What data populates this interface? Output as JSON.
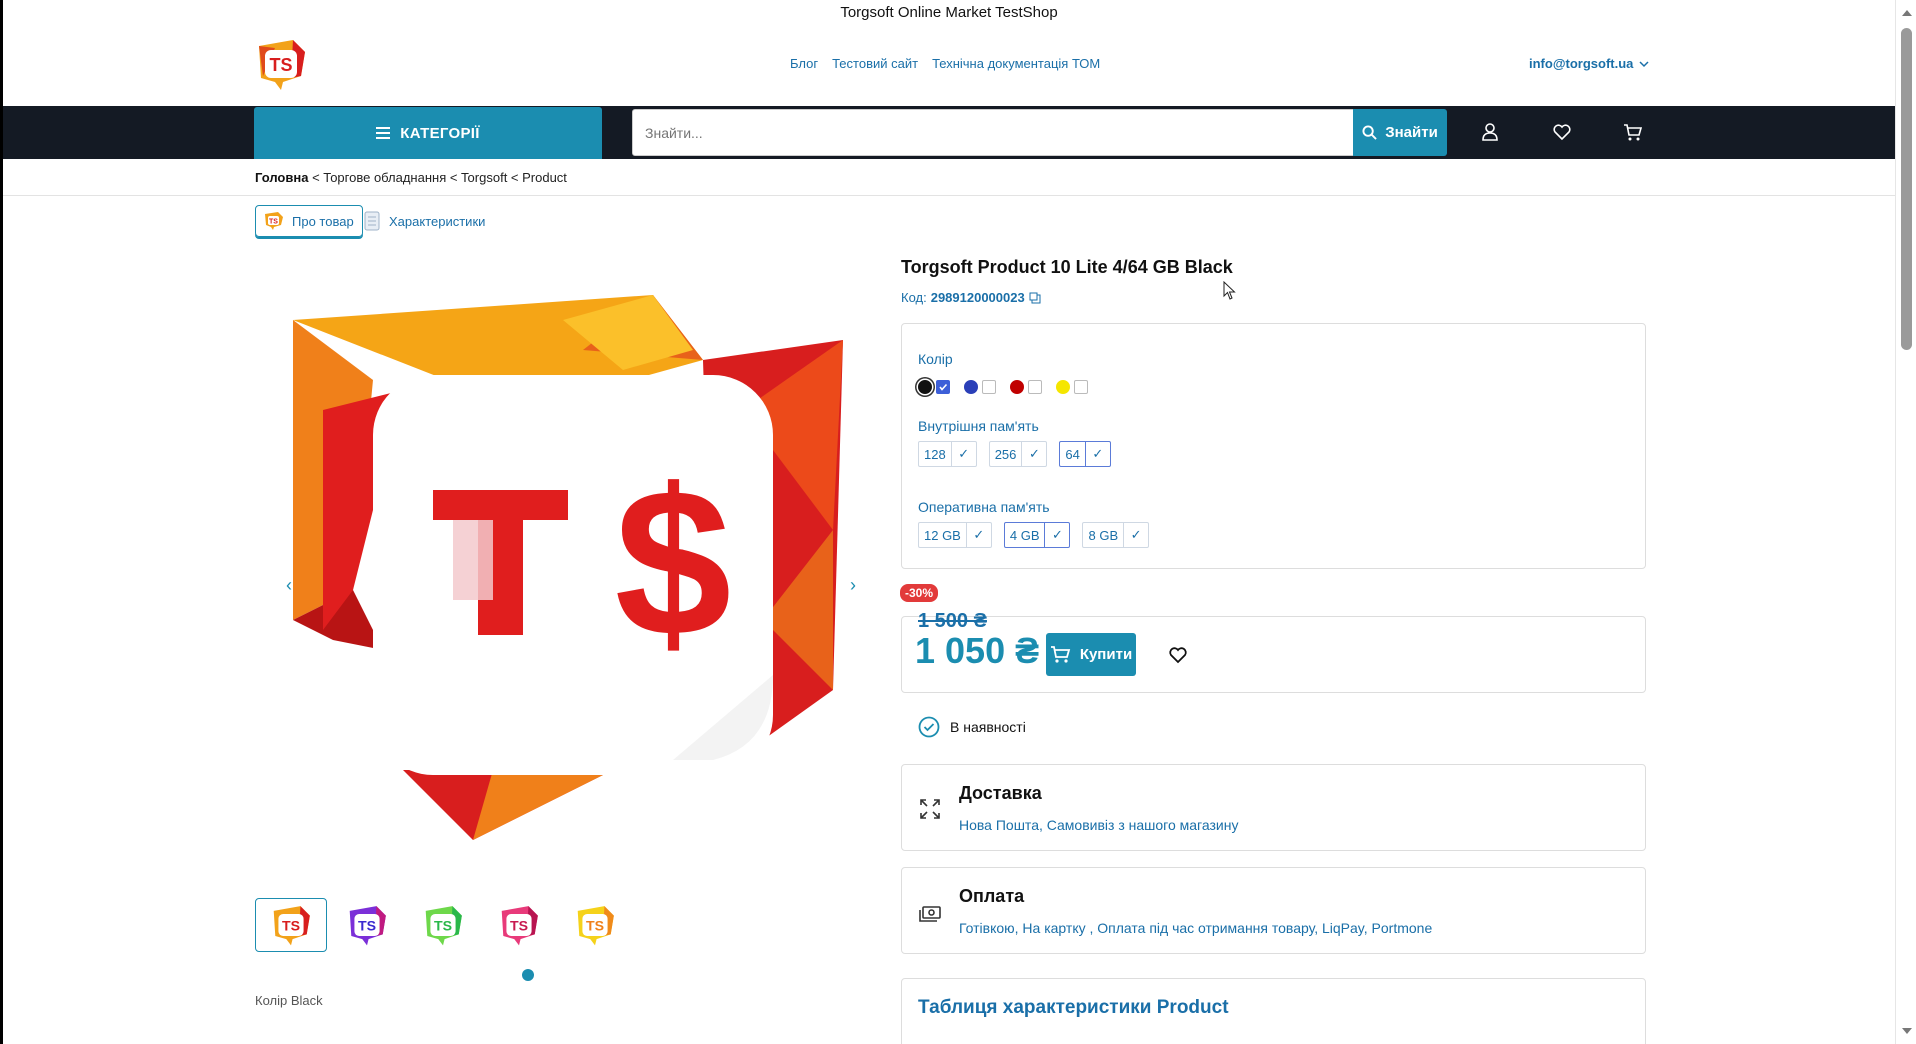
{
  "site": {
    "title": "Torgsoft Online Market TestShop"
  },
  "top_links": [
    "Блог",
    "Тестовий сайт",
    "Технічна документація ТОМ"
  ],
  "account": {
    "email": "info@torgsoft.ua"
  },
  "nav": {
    "categories_label": "КАТЕГОРІЇ",
    "search_placeholder": "Знайти...",
    "search_button": "Знайти"
  },
  "breadcrumb": {
    "home": "Головна",
    "rest": " < Торгове обладнання < Torgsoft < Product"
  },
  "tabs": {
    "about": "Про товар",
    "specs": "Характеристики"
  },
  "gallery": {
    "thumb_count": 5,
    "active_index": 0,
    "color_note": "Колір Black"
  },
  "product": {
    "title": "Torgsoft Product 10 Lite 4/64 GB Black",
    "code_label": "Код:",
    "code": "2989120000023"
  },
  "options": {
    "color_label": "Колір",
    "colors": [
      {
        "hex": "#111111",
        "checked": true
      },
      {
        "hex": "#2a3fb8",
        "checked": false
      },
      {
        "hex": "#c00000",
        "checked": false
      },
      {
        "hex": "#f5e600",
        "checked": false
      }
    ],
    "storage_label": "Внутрішня пам'ять",
    "storage": [
      {
        "label": "128",
        "selected": false
      },
      {
        "label": "256",
        "selected": false
      },
      {
        "label": "64",
        "selected": true
      }
    ],
    "ram_label": "Оперативна пам'ять",
    "ram": [
      {
        "label": "12 GB",
        "selected": false
      },
      {
        "label": "4 GB",
        "selected": true
      },
      {
        "label": "8 GB",
        "selected": false
      }
    ]
  },
  "pricing": {
    "discount": "-30%",
    "old_price": "1 500 ₴",
    "new_price": "1 050 ₴",
    "buy_label": "Купити"
  },
  "stock": {
    "label": "В наявності"
  },
  "delivery": {
    "title": "Доставка",
    "text": "Нова Пошта, Самовивіз з нашого магазину"
  },
  "payment": {
    "title": "Оплата",
    "text": "Готівкою, На картку , Оплата під час отримання товару, LiqPay, Portmone"
  },
  "specs_table": {
    "title": "Таблиця характеристики Product"
  },
  "colors": {
    "accent": "#1b8db0",
    "link": "#1a6fa8",
    "navbar": "#141a24",
    "sale": "#e23a3a"
  }
}
